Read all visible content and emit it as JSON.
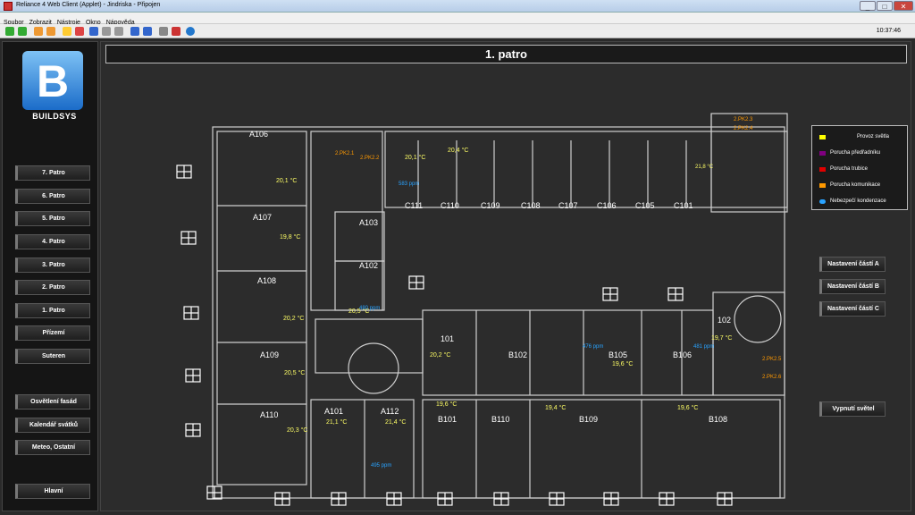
{
  "window": {
    "title": "Reliance 4 Web Client (Applet) - Jindriska - Připojen"
  },
  "menu": [
    "Soubor",
    "Zobrazit",
    "Nástroje",
    "Okno",
    "Nápověda"
  ],
  "toolbar": {
    "clock": "10:37:46"
  },
  "logo": {
    "letter": "B",
    "text": "BUILDSYS"
  },
  "nav": [
    "7. Patro",
    "6. Patro",
    "5. Patro",
    "4. Patro",
    "3. Patro",
    "2. Patro",
    "1. Patro",
    "Přízemí",
    "Suteren",
    "Osvětlení fasád",
    "Kalendář svátků",
    "Meteo, Ostatní",
    "Hlavní"
  ],
  "page_title": "1. patro",
  "legend": [
    {
      "label": "Provoz světla",
      "color": "#ffff00"
    },
    {
      "label": "Porucha předřadníku",
      "color": "#800080"
    },
    {
      "label": "Porucha trubice",
      "color": "#e00000"
    },
    {
      "label": "Porucha komunikace",
      "color": "#ff9900"
    },
    {
      "label": "Nebezpečí kondenzace",
      "color": "#29a3ff"
    }
  ],
  "right_buttons": [
    "Nastavení částí A",
    "Nastavení částí B",
    "Nastavení částí C",
    "Vypnutí světel"
  ],
  "rooms": [
    {
      "name": "A106",
      "temp": "20,1 °C"
    },
    {
      "name": "A107",
      "temp": "19,8 °C"
    },
    {
      "name": "A108",
      "temp": "20,2 °C"
    },
    {
      "name": "A109",
      "temp": "20,5 °C"
    },
    {
      "name": "A110",
      "temp": "20,3 °C"
    },
    {
      "name": "A101",
      "temp": "21,1 °C"
    },
    {
      "name": "A112",
      "temp": "21,4 °C"
    },
    {
      "name": "A103",
      "temp": ""
    },
    {
      "name": "A102",
      "temp": "20,5 °C"
    },
    {
      "name": "C111",
      "temp": "20,1 °C"
    },
    {
      "name": "C110",
      "temp": "20,4 °C"
    },
    {
      "name": "C109",
      "temp": ""
    },
    {
      "name": "C108",
      "temp": ""
    },
    {
      "name": "C107",
      "temp": ""
    },
    {
      "name": "C106",
      "temp": ""
    },
    {
      "name": "C105",
      "temp": ""
    },
    {
      "name": "C101",
      "temp": ""
    },
    {
      "name": "101",
      "temp": "20,2 °C"
    },
    {
      "name": "B102",
      "temp": ""
    },
    {
      "name": "B105",
      "temp": "19,6 °C"
    },
    {
      "name": "B106",
      "temp": ""
    },
    {
      "name": "102",
      "temp": "19,7 °C"
    },
    {
      "name": "B101",
      "temp": "19,6 °C"
    },
    {
      "name": "B110",
      "temp": ""
    },
    {
      "name": "B109",
      "temp": "19,4 °C"
    },
    {
      "name": "B108",
      "temp": "19,6 °C"
    }
  ],
  "extra": {
    "c_corner_temp": "21,8 °C",
    "ppm_a102": "480 ppm",
    "ppm_c111": "583 ppm",
    "ppm_b105": "476 ppm",
    "ppm_b106": "481 ppm",
    "ppm_a101": "495 ppm",
    "pk1": "2.PK2.1",
    "pk2": "2.PK2.2",
    "pk3": "2.PK2.3",
    "pk4": "2.PK2.4",
    "pk5": "2.PK2.5",
    "pk6": "2.PK2.6"
  }
}
